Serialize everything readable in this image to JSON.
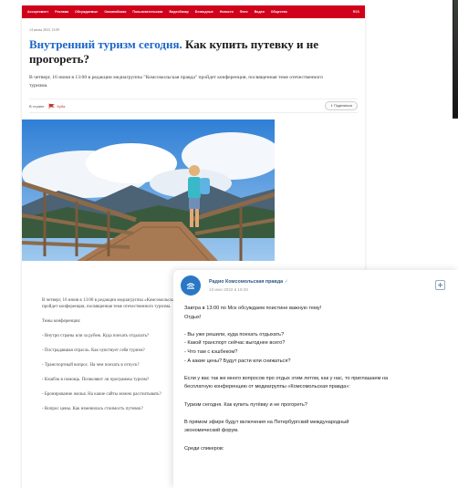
{
  "nav": {
    "items": [
      "Ассортимент",
      "Реклама",
      "Обсуждаемые",
      "Олимпийская",
      "Пользовательская",
      "Видеобазар",
      "Безвидные",
      "Новости",
      "Фото",
      "Видео",
      "Общество"
    ],
    "right": "RSS"
  },
  "article": {
    "date": "14 июня 2022 13:00",
    "title_accent": "Внутренний туризм сегодня.",
    "title_rest": " Как купить путевку и не прогореть?",
    "lead": "В четверг, 16 июня в 13:00 в редакции медиагруппы \"Комсомольская правда\" пройдет конференция, посвященная теме отечественного туризма.",
    "meta_label": "В стране",
    "tag": "Куба",
    "share_label": "Поделиться",
    "body": [
      "В четверг, 16 июня в 13:00 в редакции медиагруппы «Комсомольская правда» пройдет конференция, посвященная теме отечественного туризма.",
      "Темы конференции:",
      "- Внутри страны или за рубеж. Куда поехать отдыхать?",
      "- Пострадавшая отрасль. Как чувствует себя туризм?",
      "- Транспортный вопрос. На чем поехать в отпуск?",
      "- Кэшбэк в помощь. Позволяют ли программы туризм?",
      "- Бронирование жилья. На какие сайты можно рассчитывать?",
      "- Вопрос цены. Как изменилась стоимость путевок?"
    ]
  },
  "post": {
    "channel": "Радио Комсомольская правда",
    "date": "13 июн 2022 в 15:26",
    "text": "Завтра в 13:00 по Мск обсуждаем поистине важную тему!\nОтдых!\n\n- Вы уже решили, куда поехать отдыхать?\n- Какой транспорт сейчас выгоднее всего?\n- Что там с кэшбеком?\n- А какие цены? Будут расти или снижаться?\n\nЕсли у вас так же много вопросов про отдых этим летом, как у нас, то приглашаем на\nбесплатную конференцию от медиагруппы «Комсомольская правда»:\n\nТуризм сегодня. Как купить путёвку и не прогореть?\n\nВ прямом эфире будут включения на Петербургский международный\nэкономический форум.\n\nСреди спикеров:"
  },
  "colors": {
    "brand_red": "#d0021b",
    "link_blue": "#1b66c9",
    "channel_blue": "#2a5885"
  },
  "icons": {
    "tag": "flag-icon",
    "share": "share-icon",
    "avatar": "radio-logo-icon",
    "add": "plus-icon",
    "verified": "verified-icon"
  }
}
